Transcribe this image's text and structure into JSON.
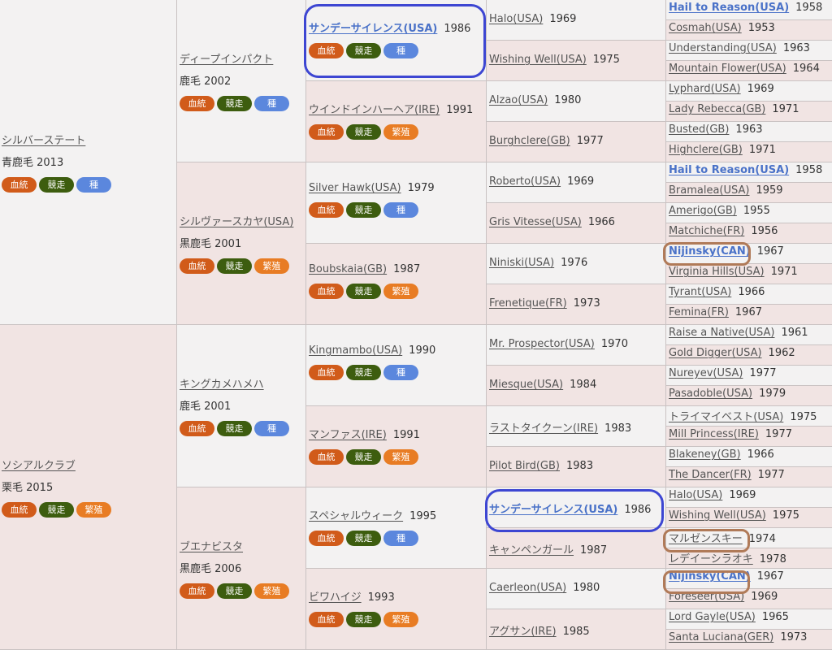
{
  "badge_labels": {
    "blood": "血統",
    "race": "競走",
    "sire": "種",
    "dam": "繁殖"
  },
  "gen1": [
    {
      "name": "シルバーステート",
      "detail": "青鹿毛 2013",
      "badges": [
        "blood",
        "race",
        "sire"
      ]
    },
    {
      "name": "ソシアルクラブ",
      "detail": "栗毛 2015",
      "badges": [
        "blood",
        "race",
        "dam"
      ]
    }
  ],
  "gen2": [
    {
      "name": "ディープインパクト",
      "detail": "鹿毛 2002",
      "badges": [
        "blood",
        "race",
        "sire"
      ]
    },
    {
      "name": "シルヴァースカヤ(USA)",
      "detail": "黒鹿毛 2001",
      "badges": [
        "blood",
        "race",
        "dam"
      ]
    },
    {
      "name": "キングカメハメハ",
      "detail": "鹿毛 2001",
      "badges": [
        "blood",
        "race",
        "sire"
      ]
    },
    {
      "name": "ブエナビスタ",
      "detail": "黒鹿毛 2006",
      "badges": [
        "blood",
        "race",
        "dam"
      ]
    }
  ],
  "gen3": [
    {
      "name": "サンデーサイレンス(USA)",
      "year": "1986",
      "badges": [
        "blood",
        "race",
        "sire"
      ],
      "hl": true
    },
    {
      "name": "ウインドインハーヘア(IRE)",
      "year": "1991",
      "badges": [
        "blood",
        "race",
        "dam"
      ]
    },
    {
      "name": "Silver Hawk(USA)",
      "year": "1979",
      "badges": [
        "blood",
        "race",
        "sire"
      ]
    },
    {
      "name": "Boubskaia(GB)",
      "year": "1987",
      "badges": [
        "blood",
        "race",
        "dam"
      ]
    },
    {
      "name": "Kingmambo(USA)",
      "year": "1990",
      "badges": [
        "blood",
        "race",
        "sire"
      ]
    },
    {
      "name": "マンファス(IRE)",
      "year": "1991",
      "badges": [
        "blood",
        "race",
        "dam"
      ]
    },
    {
      "name": "スペシャルウィーク",
      "year": "1995",
      "badges": [
        "blood",
        "race",
        "sire"
      ]
    },
    {
      "name": "ビワハイジ",
      "year": "1993",
      "badges": [
        "blood",
        "race",
        "dam"
      ]
    }
  ],
  "gen4": [
    {
      "name": "Halo(USA)",
      "year": "1969"
    },
    {
      "name": "Wishing Well(USA)",
      "year": "1975"
    },
    {
      "name": "Alzao(USA)",
      "year": "1980"
    },
    {
      "name": "Burghclere(GB)",
      "year": "1977"
    },
    {
      "name": "Roberto(USA)",
      "year": "1969"
    },
    {
      "name": "Gris Vitesse(USA)",
      "year": "1966"
    },
    {
      "name": "Niniski(USA)",
      "year": "1976"
    },
    {
      "name": "Frenetique(FR)",
      "year": "1973"
    },
    {
      "name": "Mr. Prospector(USA)",
      "year": "1970"
    },
    {
      "name": "Miesque(USA)",
      "year": "1984"
    },
    {
      "name": "ラストタイクーン(IRE)",
      "year": "1983"
    },
    {
      "name": "Pilot Bird(GB)",
      "year": "1983"
    },
    {
      "name": "サンデーサイレンス(USA)",
      "year": "1986",
      "hl": true
    },
    {
      "name": "キャンペンガール",
      "year": "1987"
    },
    {
      "name": "Caerleon(USA)",
      "year": "1980"
    },
    {
      "name": "アグサン(IRE)",
      "year": "1985"
    }
  ],
  "gen5": [
    {
      "name": "Hail to Reason(USA)",
      "year": "1958",
      "hl": true
    },
    {
      "name": "Cosmah(USA)",
      "year": "1953"
    },
    {
      "name": "Understanding(USA)",
      "year": "1963"
    },
    {
      "name": "Mountain Flower(USA)",
      "year": "1964"
    },
    {
      "name": "Lyphard(USA)",
      "year": "1969"
    },
    {
      "name": "Lady Rebecca(GB)",
      "year": "1971"
    },
    {
      "name": "Busted(GB)",
      "year": "1963"
    },
    {
      "name": "Highclere(GB)",
      "year": "1971"
    },
    {
      "name": "Hail to Reason(USA)",
      "year": "1958",
      "hl": true
    },
    {
      "name": "Bramalea(USA)",
      "year": "1959"
    },
    {
      "name": "Amerigo(GB)",
      "year": "1955"
    },
    {
      "name": "Matchiche(FR)",
      "year": "1956"
    },
    {
      "name": "Nijinsky(CAN)",
      "year": "1967",
      "hl": true
    },
    {
      "name": "Virginia Hills(USA)",
      "year": "1971"
    },
    {
      "name": "Tyrant(USA)",
      "year": "1966"
    },
    {
      "name": "Femina(FR)",
      "year": "1967"
    },
    {
      "name": "Raise a Native(USA)",
      "year": "1961"
    },
    {
      "name": "Gold Digger(USA)",
      "year": "1962"
    },
    {
      "name": "Nureyev(USA)",
      "year": "1977"
    },
    {
      "name": "Pasadoble(USA)",
      "year": "1979"
    },
    {
      "name": "トライマイベスト(USA)",
      "year": "1975"
    },
    {
      "name": "Mill Princess(IRE)",
      "year": "1977"
    },
    {
      "name": "Blakeney(GB)",
      "year": "1966"
    },
    {
      "name": "The Dancer(FR)",
      "year": "1977"
    },
    {
      "name": "Halo(USA)",
      "year": "1969"
    },
    {
      "name": "Wishing Well(USA)",
      "year": "1975"
    },
    {
      "name": "マルゼンスキー",
      "year": "1974"
    },
    {
      "name": "レデイーシラオキ",
      "year": "1978"
    },
    {
      "name": "Nijinsky(CAN)",
      "year": "1967",
      "hl": true
    },
    {
      "name": "Foreseer(USA)",
      "year": "1969"
    },
    {
      "name": "Lord Gayle(USA)",
      "year": "1965"
    },
    {
      "name": "Santa Luciana(GER)",
      "year": "1973"
    }
  ]
}
